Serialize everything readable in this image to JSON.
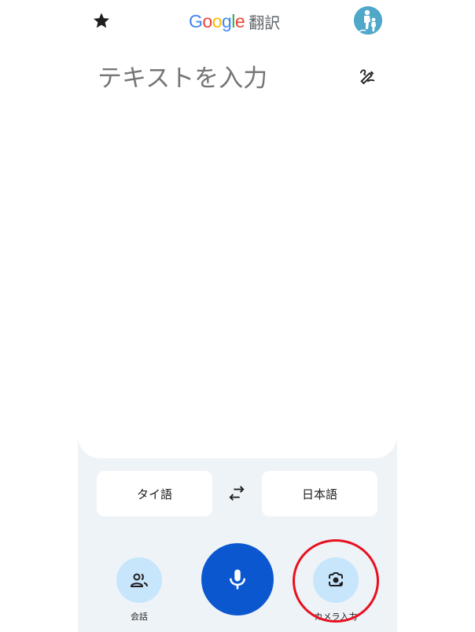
{
  "header": {
    "brand_letters": [
      "G",
      "o",
      "o",
      "g",
      "l",
      "e"
    ],
    "brand_suffix": "翻訳",
    "star_icon": "star-icon",
    "avatar": "avatar"
  },
  "input": {
    "placeholder": "テキストを入力",
    "handwriting_icon": "handwriting-icon"
  },
  "languages": {
    "source": "タイ語",
    "target": "日本語",
    "swap_icon": "swap-arrows-icon"
  },
  "actions": {
    "conversation_label": "会話",
    "conversation_icon": "people-icon",
    "mic_icon": "mic-icon",
    "camera_label": "カメラ入力",
    "camera_icon": "camera-lens-icon"
  },
  "colors": {
    "google_blue": "#4285F4",
    "google_red": "#EA4335",
    "google_yellow": "#FBBC05",
    "google_green": "#34A853",
    "mic_button": "#0b57d0",
    "secondary_button": "#c7e5fb",
    "panel_background": "#eef3f8",
    "highlight": "#e8101e"
  }
}
